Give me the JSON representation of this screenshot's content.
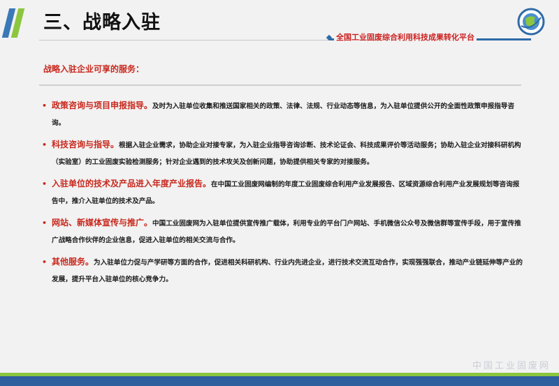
{
  "header": {
    "title": "三、战略入驻",
    "platform_name": "全国工业固废综合利用科技成果转化平台",
    "colors": {
      "accent_red": "#c8281d",
      "accent_blue": "#2e6aa8",
      "accent_green": "#8cc63f"
    },
    "logo_icon": "globe-logo-icon"
  },
  "content": {
    "subtitle": "战略入驻企业可享的服务：",
    "items": [
      {
        "title": "政策咨询与项目申报指导。",
        "text": "及时为入驻单位收集和推送国家相关的政策、法律、法规、行业动态等信息，为入驻单位提供公开的全面性政策申报指导咨询。"
      },
      {
        "title": "科技咨询与指导。",
        "text": "根据入驻企业需求，协助企业对接专家，为入驻企业指导咨询诊断、技术论证会、科技成果评价等活动服务；协助入驻企业对接科研机构（实验室）的工业固废实验检测服务；针对企业遇到的技术攻关及创新问题，协助提供相关专家的对接服务。"
      },
      {
        "title": "入驻单位的技术及产品进入年度产业报告。",
        "text": "在中国工业固废网编制的年度工业固废综合利用产业发展报告、区域资源综合利用产业发展规划等咨询报告中，推介入驻单位的技术及产品。"
      },
      {
        "title": "网站、新媒体宣传与推广。",
        "text": "中国工业固废网为入驻单位提供宣传推广载体，利用专业的平台门户网站、手机微信公众号及微信群等宣传手段，用于宣传推广战略合作伙伴的企业信息，促进入驻单位的相关交流与合作。"
      },
      {
        "title": "其他服务。",
        "text": "为入驻单位力促与产学研等方面的合作，促进相关科研机构、行业内先进企业，进行技术交流互动合作，实现强强联合，推动产业链延伸等产业的发展，提升平台入驻单位的核心竞争力。"
      }
    ]
  },
  "footer": {
    "watermark": "中国工业固废网"
  }
}
